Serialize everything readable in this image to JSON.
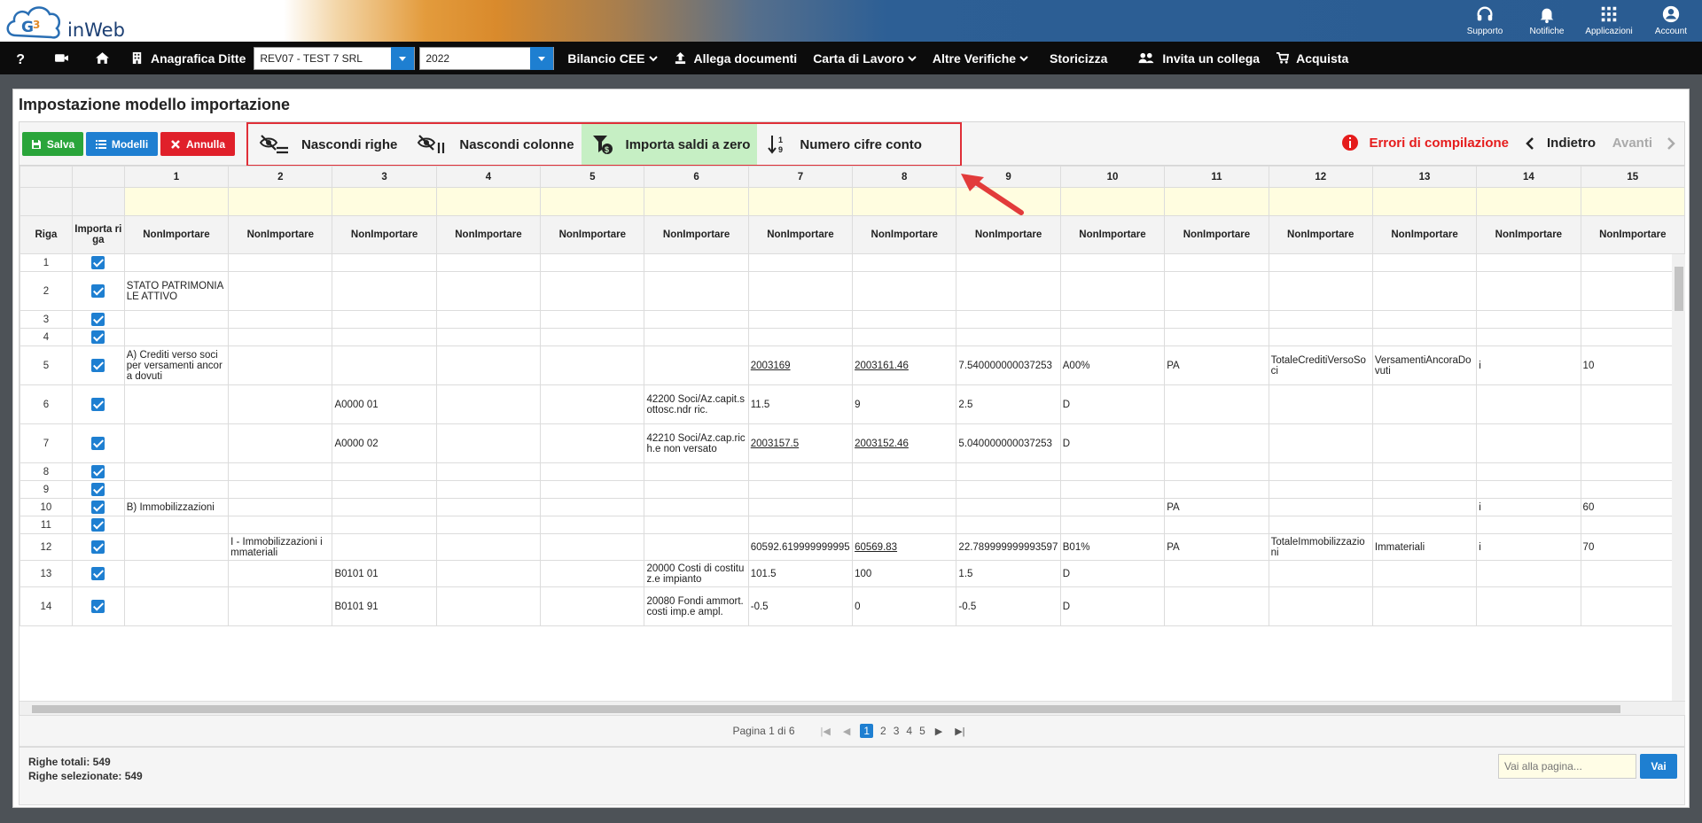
{
  "brand": {
    "name": "inWeb"
  },
  "top_actions": [
    {
      "label": "Supporto",
      "icon": "headset-icon"
    },
    {
      "label": "Notifiche",
      "icon": "bell-icon"
    },
    {
      "label": "Applicazioni",
      "icon": "apps-grid-icon"
    },
    {
      "label": "Account",
      "icon": "user-icon"
    }
  ],
  "nav": {
    "anagrafica": "Anagrafica Ditte",
    "company_value": "REV07 - TEST 7 SRL",
    "year_value": "2022",
    "bilancio": "Bilancio CEE",
    "allega": "Allega documenti",
    "carta": "Carta di Lavoro",
    "altre": "Altre Verifiche",
    "storicizza": "Storicizza",
    "invita": "Invita un collega",
    "acquista": "Acquista"
  },
  "page": {
    "title": "Impostazione modello importazione"
  },
  "toolbar": {
    "save": "Salva",
    "models": "Modelli",
    "cancel": "Annulla",
    "hide_rows": "Nascondi righe",
    "hide_cols": "Nascondi colonne",
    "import_zero": "Importa saldi a zero",
    "account_digits": "Numero cifre conto",
    "errors": "Errori di compilazione",
    "back": "Indietro",
    "next": "Avanti"
  },
  "grid": {
    "col_numbers": [
      "1",
      "2",
      "3",
      "4",
      "5",
      "6",
      "7",
      "8",
      "9",
      "10",
      "11",
      "12",
      "13",
      "14",
      "15"
    ],
    "header_riga": "Riga",
    "header_importa": "Importa riga",
    "col_type": "NonImportare",
    "rows": [
      {
        "n": "1",
        "c": [
          "",
          "",
          "",
          "",
          "",
          "",
          "",
          "",
          "",
          "",
          "",
          "",
          "",
          "",
          ""
        ]
      },
      {
        "n": "2",
        "c": [
          "STATO PATRIMONIALE ATTIVO",
          "",
          "",
          "",
          "",
          "",
          "",
          "",
          "",
          "",
          "",
          "",
          "",
          "",
          ""
        ]
      },
      {
        "n": "3",
        "c": [
          "",
          "",
          "",
          "",
          "",
          "",
          "",
          "",
          "",
          "",
          "",
          "",
          "",
          "",
          ""
        ]
      },
      {
        "n": "4",
        "c": [
          "",
          "",
          "",
          "",
          "",
          "",
          "",
          "",
          "",
          "",
          "",
          "",
          "",
          "",
          ""
        ]
      },
      {
        "n": "5",
        "c": [
          "A) Crediti verso soci per versamenti ancora dovuti",
          "",
          "",
          "",
          "",
          "",
          "2003169",
          "2003161.46",
          "7.540000000037253",
          "A00%",
          "PA",
          "TotaleCreditiVersoSoci",
          "VersamentiAncoraDovuti",
          "i",
          "10"
        ]
      },
      {
        "n": "6",
        "c": [
          "",
          "",
          "A0000 01",
          "",
          "",
          "42200 Soci/Az.capit.sottosc.ndr ric.",
          "11.5",
          "9",
          "2.5",
          "D",
          "",
          "",
          "",
          "",
          ""
        ]
      },
      {
        "n": "7",
        "c": [
          "",
          "",
          "A0000 02",
          "",
          "",
          "42210 Soci/Az.cap.rich.e non versato",
          "2003157.5",
          "2003152.46",
          "5.040000000037253",
          "D",
          "",
          "",
          "",
          "",
          ""
        ]
      },
      {
        "n": "8",
        "c": [
          "",
          "",
          "",
          "",
          "",
          "",
          "",
          "",
          "",
          "",
          "",
          "",
          "",
          "",
          ""
        ]
      },
      {
        "n": "9",
        "c": [
          "",
          "",
          "",
          "",
          "",
          "",
          "",
          "",
          "",
          "",
          "",
          "",
          "",
          "",
          ""
        ]
      },
      {
        "n": "10",
        "c": [
          "B) Immobilizzazioni",
          "",
          "",
          "",
          "",
          "",
          "",
          "",
          "",
          "",
          "PA",
          "",
          "",
          "i",
          "60"
        ]
      },
      {
        "n": "11",
        "c": [
          "",
          "",
          "",
          "",
          "",
          "",
          "",
          "",
          "",
          "",
          "",
          "",
          "",
          "",
          ""
        ]
      },
      {
        "n": "12",
        "c": [
          "",
          "I - Immobilizzazioni immateriali",
          "",
          "",
          "",
          "",
          "60592.619999999995",
          "60569.83",
          "22.789999999993597",
          "B01%",
          "PA",
          "TotaleImmobilizzazioni",
          "Immateriali",
          "i",
          "70"
        ]
      },
      {
        "n": "13",
        "c": [
          "",
          "",
          "B0101 01",
          "",
          "",
          "20000 Costi di costituz.e impianto",
          "101.5",
          "100",
          "1.5",
          "D",
          "",
          "",
          "",
          "",
          ""
        ]
      },
      {
        "n": "14",
        "c": [
          "",
          "",
          "B0101 91",
          "",
          "",
          "20080 Fondi ammort.costi imp.e ampl.",
          "-0.5",
          "0",
          "-0.5",
          "D",
          "",
          "",
          "",
          "",
          ""
        ]
      }
    ]
  },
  "pager": {
    "label": "Pagina 1 di 6",
    "pages": [
      "1",
      "2",
      "3",
      "4",
      "5"
    ]
  },
  "footer": {
    "total": "Righe totali: 549",
    "selected": "Righe selezionate: 549",
    "goto_placeholder": "Vai alla pagina...",
    "goto_btn": "Vai"
  },
  "colors": {
    "accent": "#1e7fd1",
    "save": "#2aa53a",
    "cancel": "#e0202a",
    "error": "#e51c1c",
    "highlight": "#c6efc4"
  }
}
